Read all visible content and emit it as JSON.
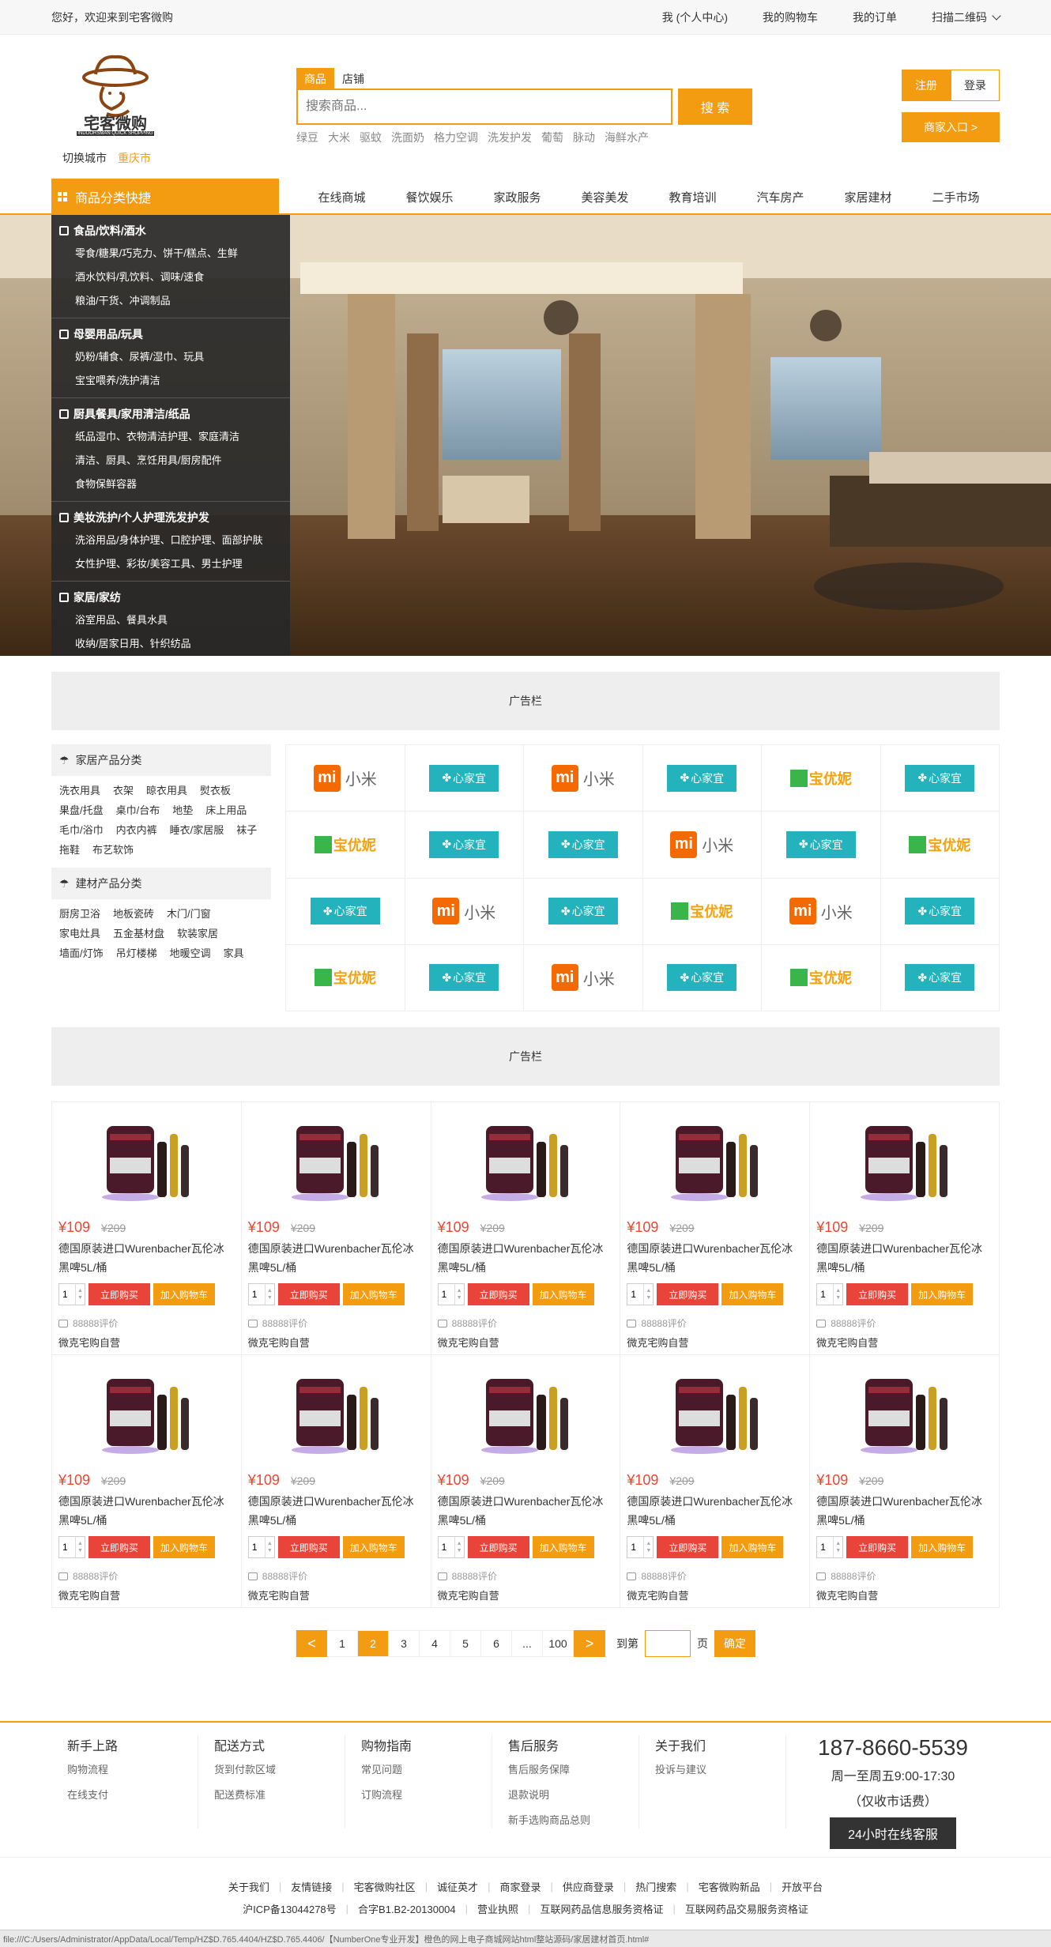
{
  "topbar": {
    "welcome": "您好，欢迎来到宅客微购",
    "links": [
      "我 (个人中心)",
      "我的购物车",
      "我的订单",
      "扫描二维码"
    ]
  },
  "header": {
    "logo_text": "宅客微购",
    "logo_sub": "INDOORSMAN  QUICK SHOPPING",
    "switch_city": "切换城市",
    "city": "重庆市",
    "search_tabs": [
      "商品",
      "店铺"
    ],
    "search_placeholder": "搜索商品...",
    "search_button": "搜 索",
    "hot_words": [
      "绿豆",
      "大米",
      "驱蚊",
      "洗面奶",
      "格力空调",
      "洗发护发",
      "葡萄",
      "脉动",
      "海鲜水产"
    ],
    "register": "注册",
    "login": "登录",
    "merchant": "商家入口 >"
  },
  "nav": {
    "category_head": "商品分类快捷",
    "items": [
      "在线商城",
      "餐饮娱乐",
      "家政服务",
      "美容美发",
      "教育培训",
      "汽车房产",
      "家居建材",
      "二手市场"
    ]
  },
  "categories": [
    {
      "title": "食品/饮料/酒水",
      "lines": [
        "零食/糖果/巧克力、饼干/糕点、生鲜",
        "酒水饮料/乳饮料、调味/速食",
        "粮油/干货、冲调制品"
      ]
    },
    {
      "title": "母婴用品/玩具",
      "lines": [
        "奶粉/辅食、尿裤/湿巾、玩具",
        "宝宝喂养/洗护清洁"
      ]
    },
    {
      "title": "厨具餐具/家用清洁/纸品",
      "lines": [
        "纸品湿巾、衣物清洁护理、家庭清洁",
        "清洁、厨具、烹饪用具/厨房配件",
        "食物保鲜容器"
      ]
    },
    {
      "title": "美妆洗护/个人护理洗发护发",
      "lines": [
        "洗浴用品/身体护理、口腔护理、面部护肤",
        "女性护理、彩妆/美容工具、男士护理"
      ]
    },
    {
      "title": "家居/家纺",
      "lines": [
        "浴室用品、餐具水具",
        "收纳/居家日用、针织纺品"
      ]
    }
  ],
  "ads": [
    "广告栏",
    "广告栏"
  ],
  "side": {
    "home_head": "家居产品分类",
    "home_items": [
      "洗衣用具",
      "衣架",
      "晾衣用具",
      "熨衣板",
      "果盘/托盘",
      "桌巾/台布",
      "地垫",
      "床上用品",
      "毛巾/浴巾",
      "内衣内裤",
      "睡衣/家居服",
      "袜子",
      "拖鞋",
      "布艺软饰"
    ],
    "build_head": "建材产品分类",
    "build_items": [
      "厨房卫浴",
      "地板瓷砖",
      "木门/门窗",
      "家电灶具",
      "五金基材盘",
      "软装家居",
      "墙面/灯饰",
      "吊灯楼梯",
      "地暖空调",
      "家具"
    ]
  },
  "brands": {
    "xiaomi_mi": "mi",
    "xiaomi_txt": "小米",
    "xjy_txt": "心家宜",
    "byn_txt": "宝优妮",
    "grid": [
      [
        "xiaomi",
        "xjy",
        "xiaomi",
        "xjy",
        "byn",
        "xjy"
      ],
      [
        "byn",
        "xjy",
        "xjy",
        "xiaomi",
        "xjy",
        "byn"
      ],
      [
        "xjy",
        "xiaomi",
        "xjy",
        "byn",
        "xiaomi",
        "xjy"
      ],
      [
        "byn",
        "xjy",
        "xiaomi",
        "xjy",
        "byn",
        "xjy"
      ]
    ]
  },
  "product": {
    "price": "¥109",
    "old_price": "¥209",
    "name": "德国原装进口Wurenbacher瓦伦冰黑啤5L/桶",
    "qty": "1",
    "buy": "立即购买",
    "cart": "加入购物车",
    "comments": "88888评价",
    "shop": "微克宅购自营"
  },
  "pager": {
    "prev": "<",
    "next": ">",
    "pages": [
      "1",
      "2",
      "3",
      "4",
      "5",
      "6",
      "...",
      "100"
    ],
    "current": "2",
    "goto_label": "到第",
    "page_unit": "页",
    "confirm": "确定"
  },
  "footer": {
    "cols": [
      {
        "h": "新手上路",
        "l": [
          "购物流程",
          "在线支付"
        ]
      },
      {
        "h": "配送方式",
        "l": [
          "货到付款区域",
          "配送费标准"
        ]
      },
      {
        "h": "购物指南",
        "l": [
          "常见问题",
          "订购流程"
        ]
      },
      {
        "h": "售后服务",
        "l": [
          "售后服务保障",
          "退款说明",
          "新手选购商品总则"
        ]
      },
      {
        "h": "关于我们",
        "l": [
          "投诉与建议"
        ]
      }
    ],
    "tel": "187-8660-5539",
    "hours": "周一至周五9:00-17:30",
    "fee": "（仅收市话费）",
    "service": "24小时在线客服",
    "links1": [
      "关于我们",
      "友情链接",
      "宅客微购社区",
      "诚征英才",
      "商家登录",
      "供应商登录",
      "热门搜索",
      "宅客微购新品",
      "开放平台"
    ],
    "links2": [
      "沪ICP备13044278号",
      "合字B1.B2-20130004",
      "营业执照",
      "互联网药品信息服务资格证",
      "互联网药品交易服务资格证"
    ]
  },
  "statusbar": "file:///C:/Users/Administrator/AppData/Local/Temp/HZ$D.765.4404/HZ$D.765.4406/【NumberOne专业开发】橙色的网上电子商城网站html整站源码/家居建材首页.html#",
  "colors": {
    "accent": "#f39c12",
    "buy": "#e8443a",
    "price": "#ee4433"
  }
}
